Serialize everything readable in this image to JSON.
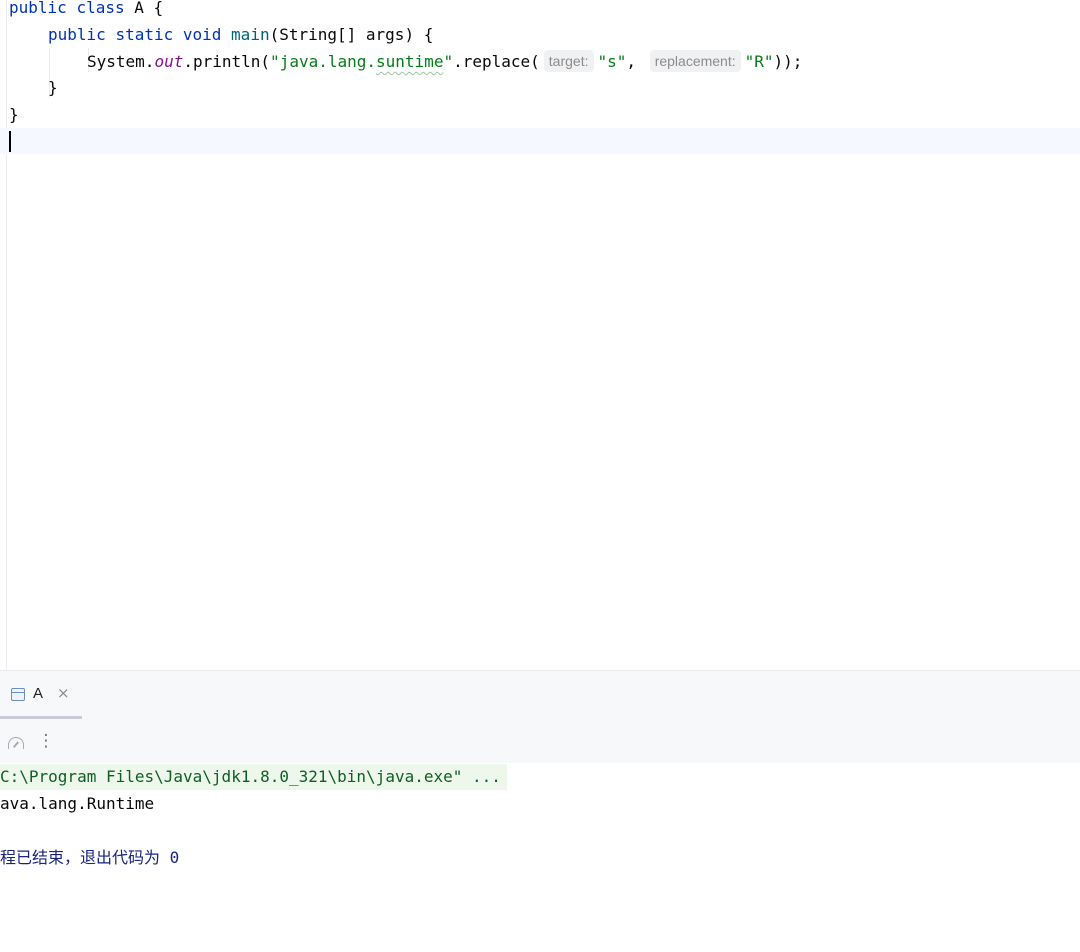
{
  "editor": {
    "line1": {
      "kw1": "public",
      "kw2": "class",
      "name": "A",
      "brace": "{"
    },
    "line2": {
      "kw1": "public",
      "kw2": "static",
      "kw3": "void",
      "method": "main",
      "params": "(String[] args) {"
    },
    "line3": {
      "system": "System.",
      "field": "out",
      "call": ".println(",
      "str_open": "\"java.lang.",
      "str_word": "suntime",
      "str_close": "\"",
      "replace": ".replace(",
      "hint_target": "target:",
      "arg1": "\"s\"",
      "comma": ",",
      "hint_replacement": "replacement:",
      "arg2": "\"R\"",
      "end": "));"
    },
    "line4": {
      "brace": "}"
    },
    "line5": {
      "brace": "}"
    }
  },
  "run_panel": {
    "tab_label": "A",
    "tab_close": "×",
    "toolbar_more": "⋮",
    "output": {
      "command": "C:\\Program Files\\Java\\jdk1.8.0_321\\bin\\java.exe\" ...",
      "stdout": "ava.lang.Runtime",
      "exit_message": "程已结束，退出代码为 ",
      "exit_code": "0"
    }
  },
  "colors": {
    "keyword": "#0033b3",
    "method": "#00627a",
    "static_field": "#871094",
    "string": "#067d17",
    "current_line": "#f5f8fe",
    "command_bg": "#edf7ec"
  }
}
